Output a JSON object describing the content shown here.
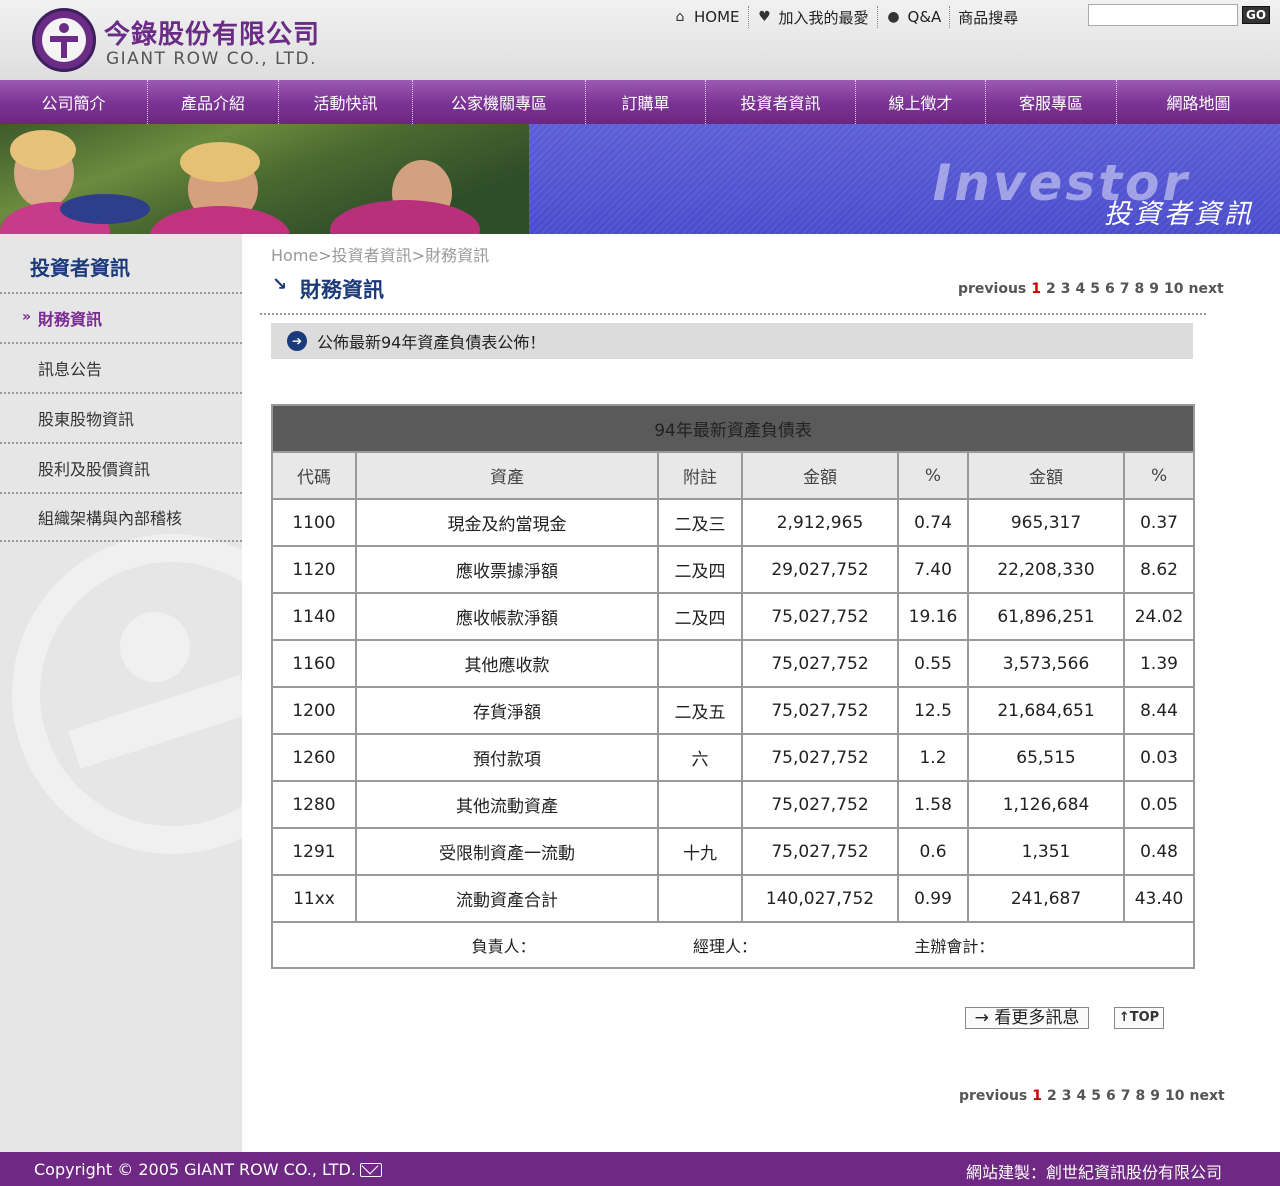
{
  "header": {
    "company_cn": "今錄股份有限公司",
    "company_en": "GIANT ROW CO., LTD.",
    "links": [
      {
        "label": "HOME",
        "icon": "home-icon",
        "glyph": "⌂"
      },
      {
        "label": "加入我的最愛",
        "icon": "favorite-icon",
        "glyph": "♥"
      },
      {
        "label": "Q&A",
        "icon": "qa-icon",
        "glyph": "●"
      }
    ],
    "search_label": "商品搜尋",
    "search_value": "",
    "go_label": "GO"
  },
  "nav": {
    "items": [
      {
        "label": "公司簡介"
      },
      {
        "label": "產品介紹"
      },
      {
        "label": "活動快訊"
      },
      {
        "label": "公家機關專區"
      },
      {
        "label": "訂購單"
      },
      {
        "label": "投資者資訊"
      },
      {
        "label": "線上徵才"
      },
      {
        "label": "客服專區"
      },
      {
        "label": "網路地圖"
      }
    ]
  },
  "banner": {
    "en": "Investor",
    "cn": "投資者資訊"
  },
  "sidebar": {
    "title": "投資者資訊",
    "items": [
      {
        "label": "財務資訊"
      },
      {
        "label": "訊息公告"
      },
      {
        "label": "股東股物資訊"
      },
      {
        "label": "股利及股價資訊"
      },
      {
        "label": "組織架構與內部稽核"
      }
    ]
  },
  "main": {
    "breadcrumb": "Home>投資者資訊>財務資訊",
    "title": "財務資訊",
    "notice": "公佈最新94年資產負債表公佈！",
    "more_label": "→ 看更多訊息",
    "top_label": "↑TOP"
  },
  "pager": {
    "previous": "previous",
    "pages": [
      "1",
      "2",
      "3",
      "4",
      "5",
      "6",
      "7",
      "8",
      "9",
      "10"
    ],
    "next": "next"
  },
  "table": {
    "title": "94年最新資產負債表",
    "headers": [
      "代碼",
      "資產",
      "附註",
      "金額",
      "%",
      "金額",
      "%"
    ],
    "rows": [
      [
        "1100",
        "現金及約當現金",
        "二及三",
        "2,912,965",
        "0.74",
        "965,317",
        "0.37"
      ],
      [
        "1120",
        "應收票據淨額",
        "二及四",
        "29,027,752",
        "7.40",
        "22,208,330",
        "8.62"
      ],
      [
        "1140",
        "應收帳款淨額",
        "二及四",
        "75,027,752",
        "19.16",
        "61,896,251",
        "24.02"
      ],
      [
        "1160",
        "其他應收款",
        "",
        "75,027,752",
        "0.55",
        "3,573,566",
        "1.39"
      ],
      [
        "1200",
        "存貨淨額",
        "二及五",
        "75,027,752",
        "12.5",
        "21,684,651",
        "8.44"
      ],
      [
        "1260",
        "預付款項",
        "六",
        "75,027,752",
        "1.2",
        "65,515",
        "0.03"
      ],
      [
        "1280",
        "其他流動資產",
        "",
        "75,027,752",
        "1.58",
        "1,126,684",
        "0.05"
      ],
      [
        "1291",
        "受限制資產一流動",
        "十九",
        "75,027,752",
        "0.6",
        "1,351",
        "0.48"
      ],
      [
        "11xx",
        "流動資產合計",
        "",
        "140,027,752",
        "0.99",
        "241,687",
        "43.40"
      ]
    ],
    "signatures": [
      "負責人：",
      "經理人：",
      "主辦會計："
    ]
  },
  "footer": {
    "copyright": "Copyright © 2005 GIANT ROW CO., LTD.",
    "builder": "網站建製：創世紀資訊股份有限公司"
  },
  "colors": {
    "brand_purple": "#7d3596",
    "title_blue": "#1b3a7a",
    "pager_current": "#cc0000"
  }
}
